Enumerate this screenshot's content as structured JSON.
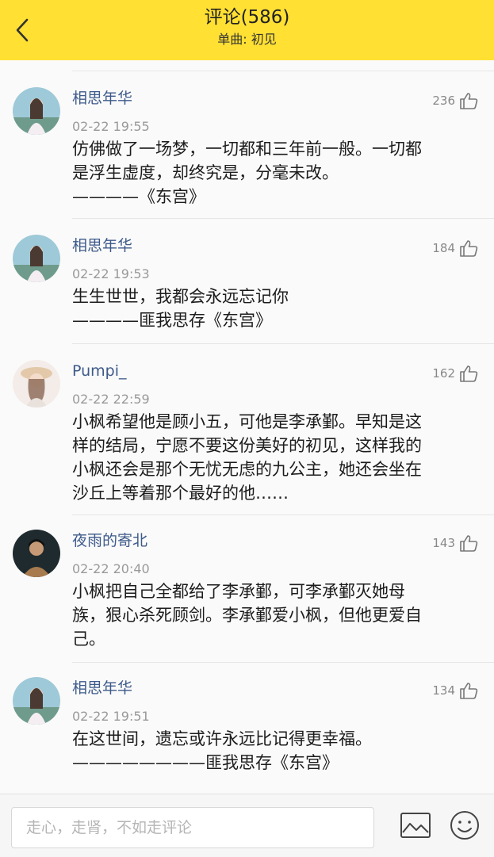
{
  "header": {
    "title": "评论(586)",
    "subtitle": "单曲: 初见",
    "back_icon": "chevron-left-icon",
    "background": "#FFE033"
  },
  "comments": [
    {
      "username": "相思年华",
      "time": "02-22 19:55",
      "likes": "236",
      "lines": [
        "仿佛做了一场梦，一切都和三年前一般。一切都",
        "是浮生虚度，却终究是，分毫未改。",
        "————《东宫》"
      ]
    },
    {
      "username": "相思年华",
      "time": "02-22 19:53",
      "likes": "184",
      "lines": [
        "生生世世，我都会永远忘记你",
        "————匪我思存《东宫》"
      ]
    },
    {
      "username": "Pumpi_",
      "time": "02-22 22:59",
      "likes": "162",
      "lines": [
        "小枫希望他是顾小五，可他是李承鄞。早知是这",
        "样的结局，宁愿不要这份美好的初见，这样我的",
        "小枫还会是那个无忧无虑的九公主，她还会坐在",
        "沙丘上等着那个最好的他……"
      ]
    },
    {
      "username": "夜雨的寄北",
      "time": "02-22 20:40",
      "likes": "143",
      "lines": [
        "小枫把自己全都给了李承鄞，可李承鄞灭她母",
        "族，狠心杀死顾剑。李承鄞爱小枫，但他更爱自",
        "己。"
      ]
    },
    {
      "username": "相思年华",
      "time": "02-22 19:51",
      "likes": "134",
      "lines": [
        "在这世间，遗忘或许永远比记得更幸福。",
        "————————匪我思存《东宫》"
      ]
    }
  ],
  "input": {
    "placeholder": "走心，走肾，不如走评论"
  },
  "icons": {
    "like": "thumbs-up-icon",
    "image": "image-icon",
    "emoji": "smiley-icon"
  }
}
